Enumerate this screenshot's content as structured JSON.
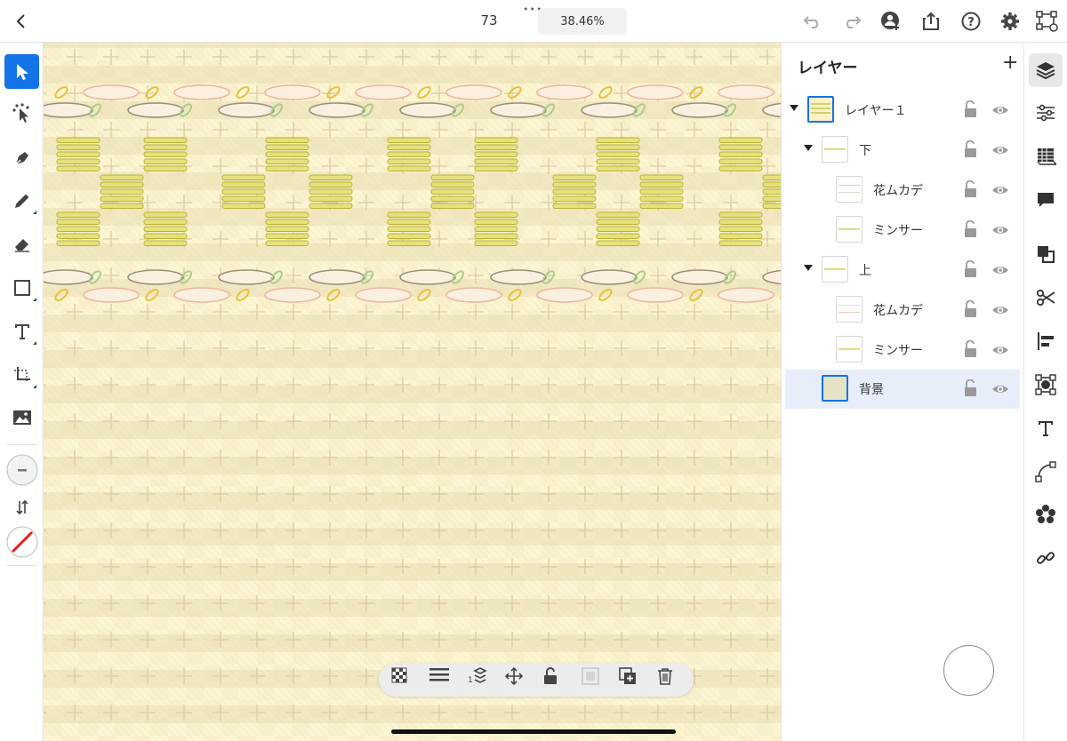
{
  "toolbar": {
    "doc_name": "73",
    "zoom": "38.46%",
    "more": "•••"
  },
  "layers_panel": {
    "title": "レイヤー",
    "add_symbol": "+",
    "rows": [
      {
        "name": "レイヤー１"
      },
      {
        "name": "下"
      },
      {
        "name": "花ムカデ"
      },
      {
        "name": "ミンサー"
      },
      {
        "name": "上"
      },
      {
        "name": "花ムカデ"
      },
      {
        "name": "ミンサー"
      },
      {
        "name": "背景"
      }
    ]
  },
  "icons": {
    "top": [
      "back-icon",
      "undo-icon",
      "redo-icon",
      "invite-icon",
      "share-icon",
      "help-icon",
      "settings-icon",
      "prototype-icon"
    ],
    "left": [
      "selection-icon",
      "direct-selection-icon",
      "pen-icon",
      "pencil-icon",
      "eraser-icon",
      "rectangle-icon",
      "type-icon",
      "transform-icon",
      "image-icon",
      "stroke-icon",
      "swap-icon",
      "no-fill-icon"
    ],
    "right": [
      "layers-icon",
      "properties-icon",
      "libraries-icon",
      "comments-icon",
      "combine-icon",
      "scissors-icon",
      "align-icon",
      "transform-panel-icon",
      "type-panel-icon",
      "path-icon",
      "repeat-icon",
      "link-icon"
    ],
    "float": [
      "opacity-icon",
      "blend-icon",
      "arrange-icon",
      "move-icon",
      "lock-icon",
      "mask-icon",
      "duplicate-icon",
      "delete-icon"
    ]
  },
  "colors": {
    "accent": "#1473e6",
    "canvas_bg": "#fdf6d3",
    "stripe_fill": "#e6e27a",
    "stripe_stroke": "#b9b23a",
    "grid_cross": "#d9c9a3",
    "ellipse_pink": "#f0b59a",
    "ellipse_brown": "#9a8e7a",
    "leaf_yellow": "#e6c23a",
    "leaf_green": "#a5d08a"
  }
}
